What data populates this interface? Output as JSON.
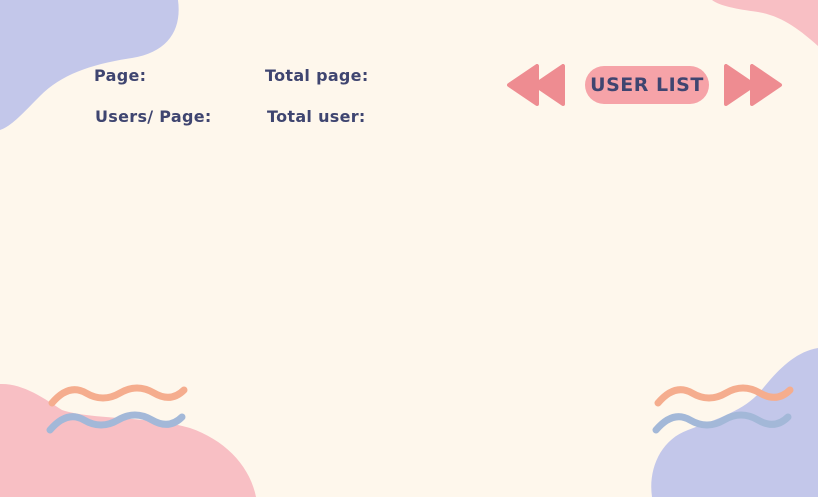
{
  "header": {
    "title": "USER LIST",
    "page_label": "Page:",
    "total_page_label": "Total page:",
    "users_per_page_label": "Users/ Page:",
    "total_user_label": "Total user:"
  },
  "navigation": {
    "prev_icon": "double-chevron-left-icon",
    "next_icon": "double-chevron-right-icon"
  },
  "colors": {
    "background": "#fef7ec",
    "text": "#3f4570",
    "accent_pink": "#f6a3a8",
    "arrow": "#ee8c91",
    "blob_lavender": "#c3c7ea",
    "blob_pink": "#f8bfc4",
    "wave_orange": "#f5ad8e",
    "wave_blue": "#a3b8d8"
  }
}
